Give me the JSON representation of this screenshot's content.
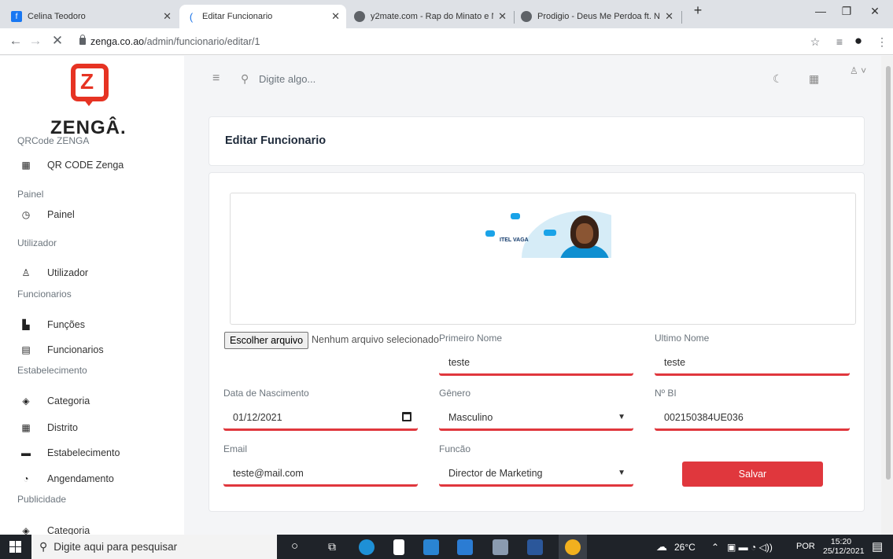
{
  "browser": {
    "tabs": [
      {
        "title": "Celina Teodoro",
        "icon": "facebook-icon"
      },
      {
        "title": "Editar Funcionario",
        "icon": "loading-icon"
      },
      {
        "title": "y2mate.com - Rap do Minato e N",
        "icon": "globe-icon"
      },
      {
        "title": "Prodigio - Deus Me Perdoa ft. Ng",
        "icon": "globe-icon"
      }
    ],
    "url_host": "zenga.co.ao",
    "url_path": "/admin/funcionario/editar/1"
  },
  "brand": {
    "name": "ZENGÂ.",
    "accent": "#e63323"
  },
  "sidebar": {
    "sections": [
      {
        "label": "QRCode ZENGA",
        "items": [
          {
            "label": "QR CODE Zenga",
            "icon": "building-icon"
          }
        ]
      },
      {
        "label": "Painel",
        "items": [
          {
            "label": "Painel",
            "icon": "dashboard-icon"
          }
        ]
      },
      {
        "label": "Utilizador",
        "items": [
          {
            "label": "Utilizador",
            "icon": "user-icon"
          }
        ]
      },
      {
        "label": "Funcionarios",
        "items": [
          {
            "label": "Funções",
            "icon": "chart-icon"
          },
          {
            "label": "Funcionarios",
            "icon": "id-card-icon"
          }
        ]
      },
      {
        "label": "Estabelecimento",
        "items": [
          {
            "label": "Categoria",
            "icon": "layers-icon"
          },
          {
            "label": "Distrito",
            "icon": "building-icon"
          },
          {
            "label": "Estabelecimento",
            "icon": "store-icon"
          },
          {
            "label": "Angendamento",
            "icon": "clock-icon"
          }
        ]
      },
      {
        "label": "Publicidade",
        "items": [
          {
            "label": "Categoria",
            "icon": "layers-icon"
          }
        ]
      }
    ]
  },
  "topbar": {
    "search_placeholder": "Digite algo..."
  },
  "page": {
    "title": "Editar Funcionario"
  },
  "form": {
    "banner_text": "ITEL VAGA",
    "file_button": "Escolher arquivo",
    "file_status": "Nenhum arquivo selecionado",
    "first_name": {
      "label": "Primeiro Nome",
      "value": "teste"
    },
    "last_name": {
      "label": "Ultimo Nome",
      "value": "teste"
    },
    "birth_date": {
      "label": "Data de Nascimento",
      "value": "01/12/2021"
    },
    "gender": {
      "label": "Gênero",
      "value": "Masculino"
    },
    "bi": {
      "label": "Nº BI",
      "value": "002150384UE036"
    },
    "email": {
      "label": "Email",
      "value": "teste@mail.com"
    },
    "role": {
      "label": "Funcão",
      "value": "Director de Marketing"
    },
    "submit": "Salvar",
    "accent": "#e0373d"
  },
  "taskbar": {
    "search_placeholder": "Digite aqui para pesquisar",
    "weather": "26°C",
    "language": "POR",
    "time": "15:20",
    "date": "25/12/2021"
  }
}
